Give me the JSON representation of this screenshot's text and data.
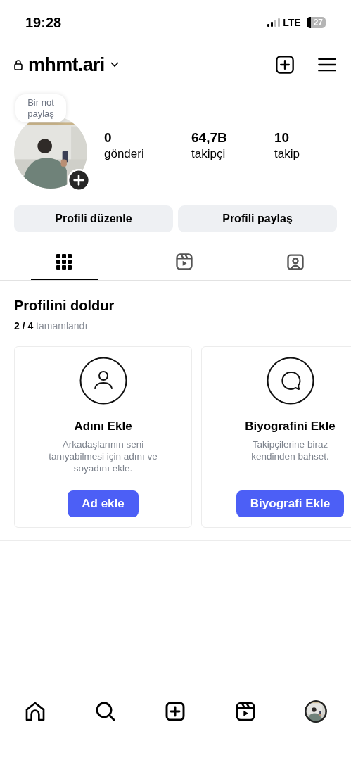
{
  "status_bar": {
    "time": "19:28",
    "network": "LTE",
    "battery": "27"
  },
  "header": {
    "username": "mhmt.ari"
  },
  "note": {
    "text": "Bir not paylaş"
  },
  "stats": [
    {
      "value": "0",
      "label": "gönderi"
    },
    {
      "value": "64,7B",
      "label": "takipçi"
    },
    {
      "value": "10",
      "label": "takip"
    }
  ],
  "buttons": [
    "Profili düzenle",
    "Profili paylaş"
  ],
  "tabs": [
    {
      "kind": "grid",
      "selected": true
    },
    {
      "kind": "reels",
      "selected": false
    },
    {
      "kind": "tagged",
      "selected": false
    }
  ],
  "completion": {
    "title": "Profilini doldur",
    "progress": "2 / 4",
    "progress_label": "tamamlandı",
    "cards": [
      {
        "kind": "name",
        "title": "Adını Ekle",
        "description": "Arkadaşlarının seni tanıyabilmesi için adını ve soyadını ekle.",
        "button": "Ad ekle"
      },
      {
        "kind": "bio",
        "title": "Biyografini Ekle",
        "description": "Takipçilerine biraz kendinden bahset.",
        "button": "Biyografi Ekle"
      }
    ]
  },
  "bottom_nav": [
    {
      "kind": "home"
    },
    {
      "kind": "search"
    },
    {
      "kind": "create"
    },
    {
      "kind": "reels"
    },
    {
      "kind": "profile"
    }
  ]
}
